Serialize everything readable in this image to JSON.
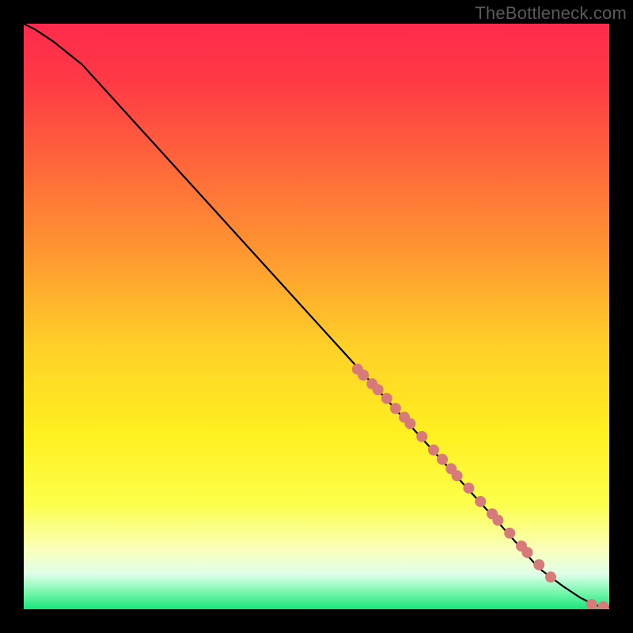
{
  "attribution": "TheBottleneck.com",
  "chart_data": {
    "type": "line",
    "title": "",
    "xlabel": "",
    "ylabel": "",
    "xlim": [
      0,
      100
    ],
    "ylim": [
      0,
      100
    ],
    "curve": {
      "x": [
        0,
        2,
        5,
        10,
        20,
        30,
        40,
        50,
        60,
        70,
        80,
        88,
        92,
        95,
        97,
        98,
        99,
        100
      ],
      "y": [
        100,
        99,
        97,
        93,
        82,
        71,
        60,
        49,
        38,
        27,
        16,
        7,
        4,
        2,
        1,
        0.6,
        0.4,
        0.4
      ]
    },
    "markers": {
      "x": [
        57,
        58,
        59.5,
        60.5,
        62,
        63.5,
        65,
        66,
        68,
        70,
        71.5,
        73,
        74,
        76,
        78,
        80,
        81,
        83,
        85,
        86,
        88,
        90,
        97,
        99
      ],
      "y": [
        41,
        40,
        38.5,
        37.5,
        36,
        34.3,
        32.8,
        31.7,
        29.5,
        27.2,
        25.6,
        24,
        22.8,
        20.7,
        18.4,
        16.3,
        15.2,
        13,
        10.8,
        9.7,
        7.6,
        5.5,
        0.8,
        0.4
      ],
      "color": "#d97a7a",
      "radius": 7
    },
    "gradient_stops": [
      {
        "offset": 0.0,
        "color": "#ff2a4d"
      },
      {
        "offset": 0.1,
        "color": "#ff3a45"
      },
      {
        "offset": 0.25,
        "color": "#ff6a3a"
      },
      {
        "offset": 0.4,
        "color": "#ff9a30"
      },
      {
        "offset": 0.55,
        "color": "#ffd028"
      },
      {
        "offset": 0.7,
        "color": "#fff020"
      },
      {
        "offset": 0.82,
        "color": "#fcff4a"
      },
      {
        "offset": 0.9,
        "color": "#faffbe"
      },
      {
        "offset": 0.94,
        "color": "#dfffe8"
      },
      {
        "offset": 0.97,
        "color": "#7cf7af"
      },
      {
        "offset": 1.0,
        "color": "#18e67a"
      }
    ]
  }
}
